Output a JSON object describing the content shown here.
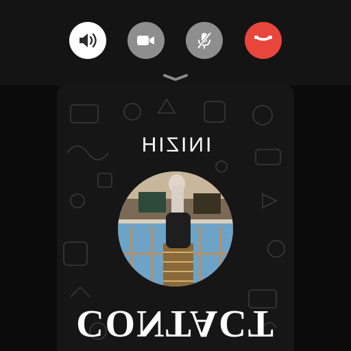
{
  "call_controls": {
    "speaker_icon": "speaker-icon",
    "video_icon": "video-camera-icon",
    "mic_icon": "mic-off-icon",
    "end_icon": "end-call-icon",
    "colors": {
      "speaker": "#ffffff",
      "inactive": "#8e8e8e",
      "end": "#e8453c"
    }
  },
  "caller": {
    "name": "INIZIH",
    "label": "CONTACT",
    "avatar_icon": "profile-photo"
  },
  "handle_icon": "chevron-down-icon"
}
